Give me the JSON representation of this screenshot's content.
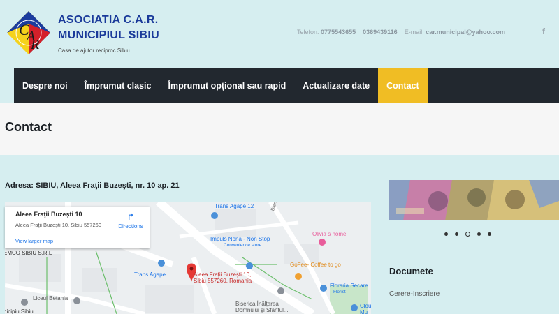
{
  "org": {
    "logo_text": "CAR",
    "name_line1": "ASOCIATIA C.A.R.",
    "name_line2": "MUNICIPIUL SIBIU",
    "tagline": "Casa de ajutor reciproc Sibiu"
  },
  "contact": {
    "phone_label": "Telefon:",
    "phone1": "0775543655",
    "phone2": "0369439116",
    "email_label": "E-mail:",
    "email": "car.municipal@yahoo.com",
    "social_icon": "facebook-icon"
  },
  "nav": {
    "items": [
      {
        "label": "Despre noi"
      },
      {
        "label": "Împrumut clasic"
      },
      {
        "label": "Împrumut opțional sau rapid"
      },
      {
        "label": "Actualizare date"
      },
      {
        "label": "Contact"
      }
    ],
    "active": "Contact",
    "active_color": "#f0bd24"
  },
  "page": {
    "title": "Contact",
    "address": "Adresa: SIBIU, Aleea Fraţii Buzeşti, nr. 10 ap. 21"
  },
  "map": {
    "card_title": "Aleea Fraţii Buzeşti 10",
    "card_address": "Aleea Fraţii Buzeşti 10, Sibiu 557260",
    "directions_label": "Directions",
    "view_larger": "View larger map",
    "pin_label_1": "Aleea Fraţii Buzeşti 10,",
    "pin_label_2": "Sibiu 557260, Romania",
    "places": {
      "trans_agape_12": "Trans Agape 12",
      "bieruntelei": "Bieruntelei",
      "olivia": "Olivia s home",
      "impuls": "Impuls Nona - Non Stop",
      "convenience": "Convenience store",
      "emco": "EMCO SIBIU S.R.L",
      "trans_agape": "Trans Agape",
      "gofee": "GoFee- Coffee to go",
      "floraria": "Floraria Secare",
      "florist": "Florist",
      "liceul": "Liceul Betania",
      "biserica_1": "Biserica Înălțarea",
      "biserica_2": "Domnului și Sfântul...",
      "clou_1": "Clou",
      "clou_2": "Mu",
      "municipiu": "nicipiu Sibiu"
    }
  },
  "slider": {
    "dots": 5,
    "active_index": 2
  },
  "sidebar": {
    "title": "Documete",
    "links": [
      {
        "label": "Cerere-Inscriere"
      }
    ]
  }
}
